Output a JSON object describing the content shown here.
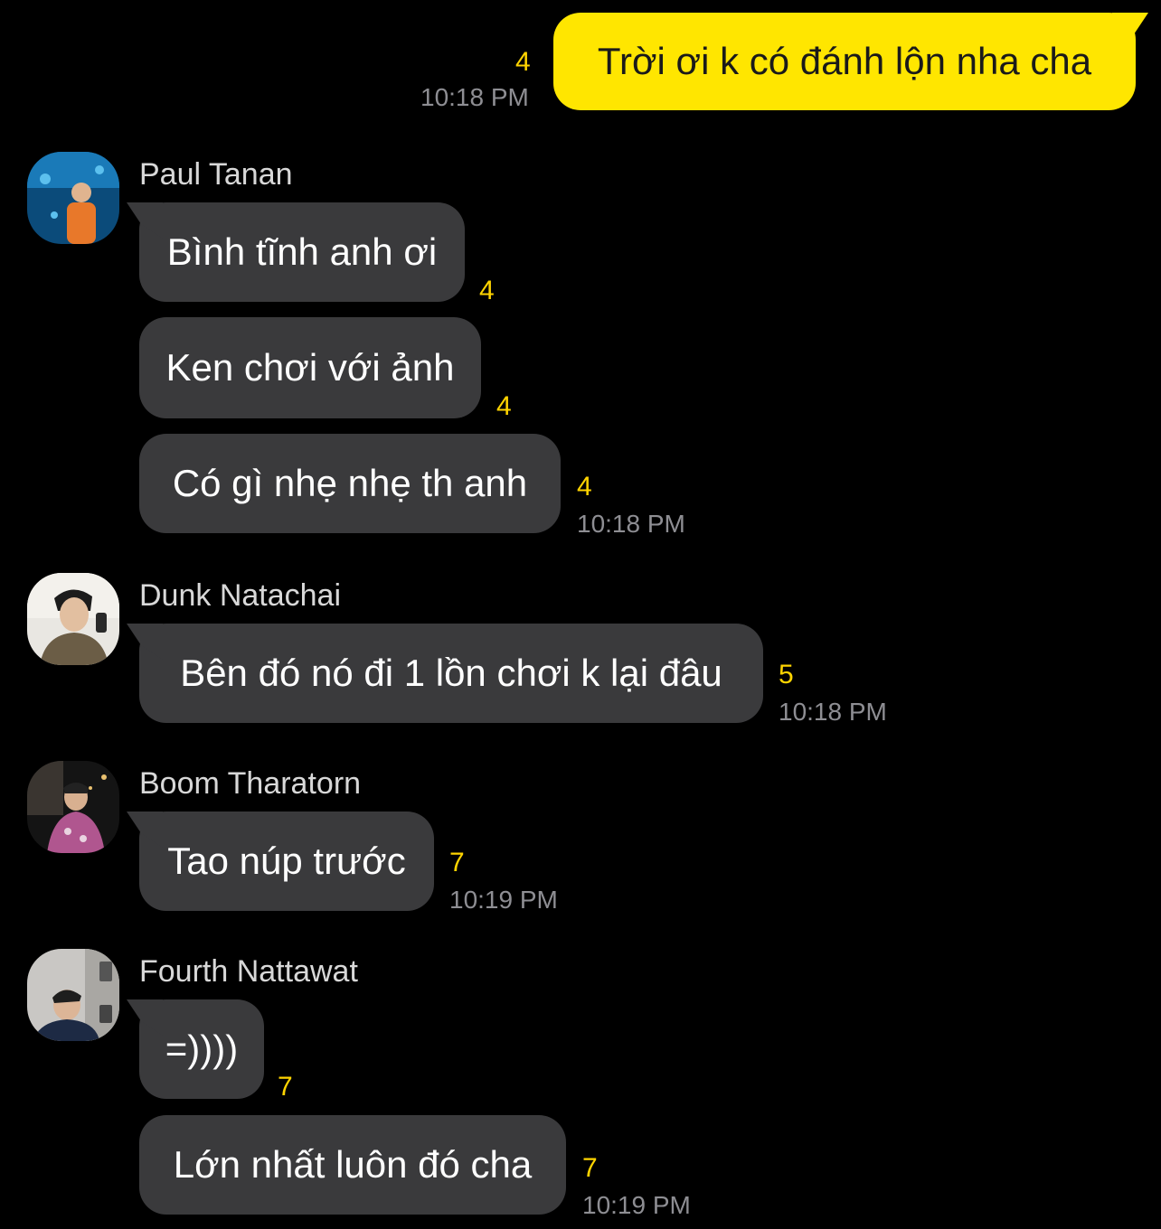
{
  "outgoing": {
    "text": "Trời ơi k có đánh lộn nha cha",
    "unread": "4",
    "time": "10:18 PM"
  },
  "groups": [
    {
      "sender": "Paul Tanan",
      "messages": [
        {
          "text": "Bình tĩnh anh ơi",
          "unread": "4"
        },
        {
          "text": "Ken chơi với ảnh",
          "unread": "4"
        },
        {
          "text": "Có gì nhẹ nhẹ th anh",
          "unread": "4",
          "time": "10:18 PM"
        }
      ]
    },
    {
      "sender": "Dunk Natachai",
      "messages": [
        {
          "text": "Bên đó nó đi 1 lồn chơi k lại đâu",
          "unread": "5",
          "time": "10:18 PM"
        }
      ]
    },
    {
      "sender": "Boom Tharatorn",
      "messages": [
        {
          "text": "Tao núp trước",
          "unread": "7",
          "time": "10:19 PM"
        }
      ]
    },
    {
      "sender": "Fourth Nattawat",
      "messages": [
        {
          "text": "=))))",
          "unread": "7"
        },
        {
          "text": "Lớn nhất luôn đó cha",
          "unread": "7",
          "time": "10:19 PM"
        }
      ]
    }
  ],
  "colors": {
    "background": "#000000",
    "outgoing_bubble": "#ffe600",
    "incoming_bubble": "#3a3a3c",
    "unread_count": "#ffd400",
    "timestamp": "#8e8e93"
  }
}
